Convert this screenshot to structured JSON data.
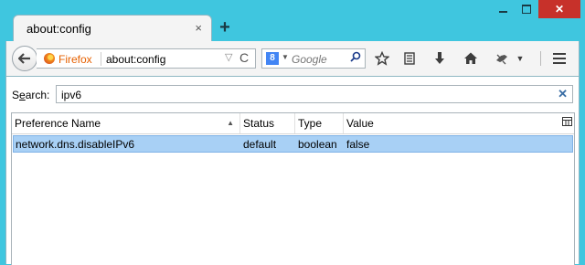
{
  "tab": {
    "title": "about:config",
    "close": "×",
    "new_tab": "+"
  },
  "window": {
    "close": "✕"
  },
  "urlbar": {
    "identity": "Firefox",
    "url": "about:config",
    "dropdown": "▽",
    "reload": "C"
  },
  "searchbar": {
    "engine": "8",
    "placeholder": "Google"
  },
  "content": {
    "search_label_prefix": "S",
    "search_label_underlined": "e",
    "search_label_suffix": "arch:",
    "filter_value": "ipv6",
    "clear": "✕"
  },
  "table": {
    "columns": [
      "Preference Name",
      "Status",
      "Type",
      "Value"
    ],
    "rows": [
      {
        "name": "network.dns.disableIPv6",
        "status": "default",
        "type": "boolean",
        "value": "false"
      }
    ]
  },
  "colors": {
    "window_frame": "#3fc6df",
    "close_button": "#c7312a",
    "selected_row": "#a8d0f5",
    "firefox_label": "#e66000"
  },
  "icons": [
    "back-icon",
    "firefox-icon",
    "search-engine-icon",
    "bookmark-star-icon",
    "bookmarks-menu-icon",
    "download-icon",
    "home-icon",
    "addon-icon",
    "menu-icon",
    "column-picker-icon"
  ]
}
